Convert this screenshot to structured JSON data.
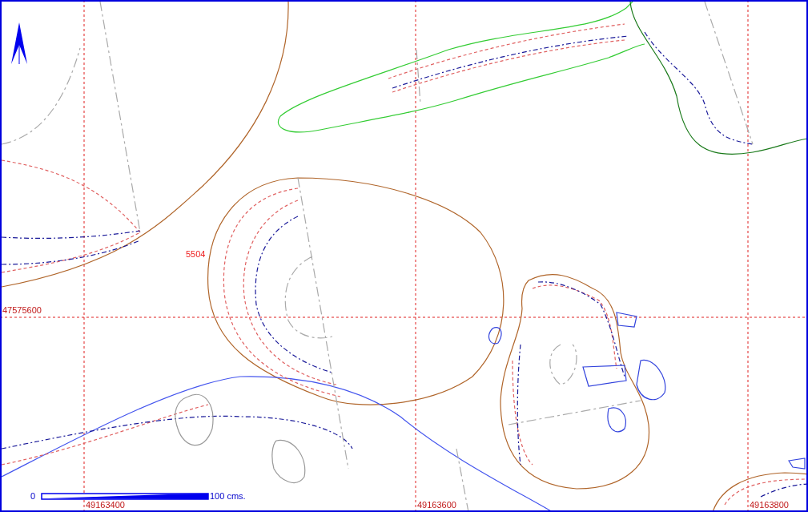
{
  "map": {
    "feature_labels": [
      {
        "text": "5504",
        "kind": "feature"
      }
    ],
    "northing_labels": [
      "47575600"
    ],
    "easting_labels": [
      "49163400",
      "49163600",
      "49163800"
    ],
    "scale_bar": {
      "start": "0",
      "end": "100 cms."
    }
  }
}
